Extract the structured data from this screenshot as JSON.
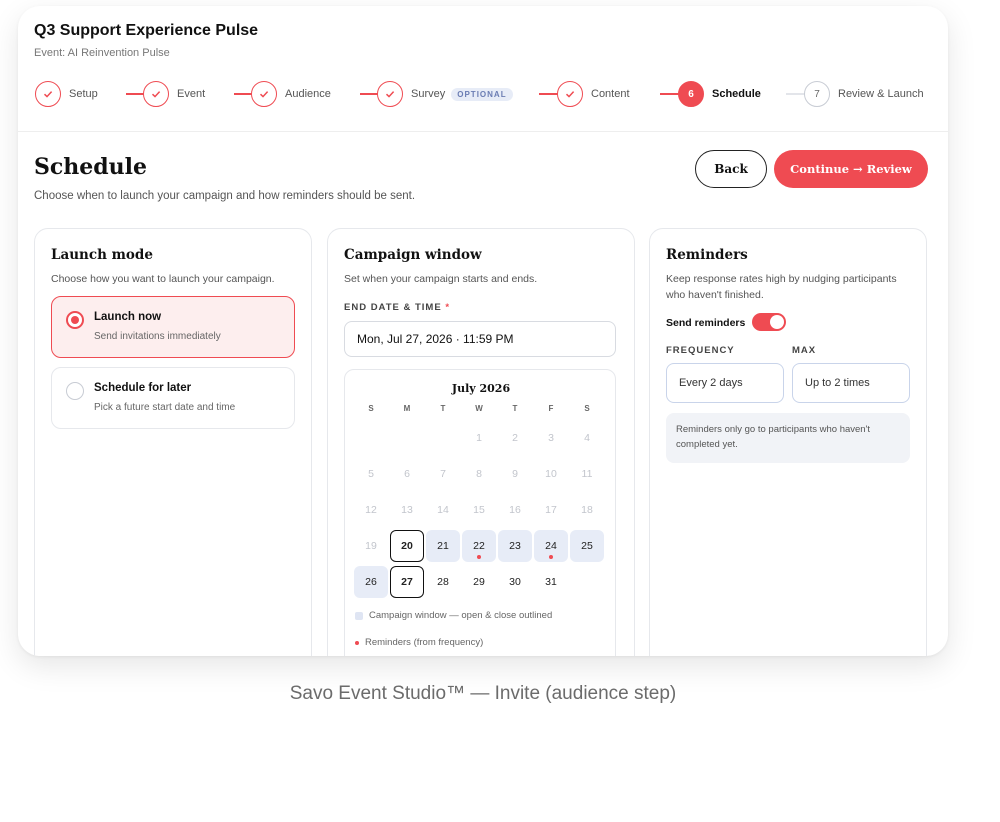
{
  "header": {
    "title": "Q3 Support Experience Pulse",
    "subtitle": "Event: AI Reinvention Pulse"
  },
  "stepper": {
    "steps": [
      {
        "label": "Setup",
        "state": "done"
      },
      {
        "label": "Event",
        "state": "done"
      },
      {
        "label": "Audience",
        "state": "done"
      },
      {
        "label": "Survey",
        "state": "done",
        "badge": "OPTIONAL"
      },
      {
        "label": "Content",
        "state": "done"
      },
      {
        "label": "Schedule",
        "state": "current",
        "number": "6"
      },
      {
        "label": "Review & Launch",
        "state": "future",
        "number": "7"
      }
    ]
  },
  "page": {
    "title": "Schedule",
    "subtitle": "Choose when to launch your campaign and how reminders should be sent.",
    "back_label": "Back",
    "continue_label": "Continue → Review"
  },
  "launch_mode": {
    "title": "Launch mode",
    "subtitle": "Choose how you want to launch your campaign.",
    "options": [
      {
        "title": "Launch now",
        "subtitle": "Send invitations immediately",
        "selected": true
      },
      {
        "title": "Schedule for later",
        "subtitle": "Pick a future start date and time",
        "selected": false
      }
    ]
  },
  "campaign_window": {
    "title": "Campaign window",
    "subtitle": "Set when your campaign starts and ends.",
    "end_label": "END DATE & TIME",
    "required_mark": "*",
    "end_value": "Mon, Jul 27, 2026 · 11:59 PM",
    "calendar": {
      "month": "July 2026",
      "weekdays": [
        "S",
        "M",
        "T",
        "W",
        "T",
        "F",
        "S"
      ],
      "weeks": [
        [
          "",
          "",
          "",
          "1",
          "2",
          "3",
          "4"
        ],
        [
          "5",
          "6",
          "7",
          "8",
          "9",
          "10",
          "11"
        ],
        [
          "12",
          "13",
          "14",
          "15",
          "16",
          "17",
          "18"
        ],
        [
          "19",
          "20",
          "21",
          "22",
          "23",
          "24",
          "25"
        ],
        [
          "26",
          "27",
          "28",
          "29",
          "30",
          "31",
          ""
        ]
      ],
      "disabled_through": 19,
      "window_start": 20,
      "window_end": 27,
      "reminder_days": [
        22,
        24
      ],
      "legend_window": "Campaign window — open & close outlined",
      "legend_reminders": "Reminders (from frequency)"
    }
  },
  "reminders": {
    "title": "Reminders",
    "subtitle_line1": "Keep response rates high by nudging participants",
    "subtitle_line2": "who haven't finished.",
    "toggle_label": "Send reminders",
    "toggle_on": true,
    "frequency_label": "FREQUENCY",
    "frequency_value": "Every 2 days",
    "max_label": "MAX",
    "max_value": "Up to 2 times",
    "note_line1": "Reminders only go to participants who haven't",
    "note_line2": "completed yet."
  },
  "caption": "Savo Event Studio™ — Invite (audience step)",
  "colors": {
    "accent": "#ef4b52",
    "window_fill": "#e7ecf7"
  }
}
